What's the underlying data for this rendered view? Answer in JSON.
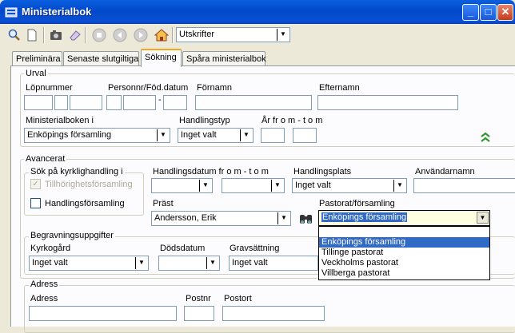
{
  "window": {
    "title": "Ministerialbok"
  },
  "toolbar": {
    "icons": [
      "search-icon",
      "new-document-icon",
      "camera-icon",
      "eraser-icon",
      "stop-icon",
      "back-icon",
      "forward-icon",
      "home-icon"
    ],
    "report_combo_value": "Utskrifter"
  },
  "tabs": [
    {
      "label": "Preliminära"
    },
    {
      "label": "Senaste slutgiltiga"
    },
    {
      "label": "Sökning"
    },
    {
      "label": "Spåra ministerialbok"
    }
  ],
  "urval": {
    "legend": "Urval",
    "lopnummer_label": "Löpnummer",
    "personnr_label": "Personnr/Föd.datum",
    "personnr_dash": "-",
    "fornamn_label": "Förnamn",
    "efternamn_label": "Efternamn",
    "ministerialboken_label": "Ministerialboken i",
    "ministerialboken_value": "Enköpings församling",
    "handlingstyp_label": "Handlingstyp",
    "handlingstyp_value": "Inget valt",
    "ar_label": "År fr o m - t o m"
  },
  "avancerat": {
    "legend": "Avancerat",
    "kyrklig": {
      "legend": "Sök på kyrklighandling i",
      "tillhorighet_label": "Tillhörighetsförsamling",
      "tillhorighet_checked": true,
      "handlings_label": "Handlingsförsamling",
      "handlings_checked": false
    },
    "handlingsdatum_label": "Handlingsdatum fr o m - t o m",
    "handlingsplats_label": "Handlingsplats",
    "handlingsplats_value": "Inget valt",
    "anvandarnamn_label": "Användarnamn",
    "prast_label": "Präst",
    "prast_value": "Andersson, Erik",
    "pastorat_label": "Pastorat/församling",
    "pastorat_value": "Enköpings församling",
    "pastorat_options": [
      "",
      "Enköpings församling",
      "Tillinge pastorat",
      "Veckholms pastorat",
      "Villberga pastorat"
    ],
    "pastorat_selected_index": 1
  },
  "begravning": {
    "legend": "Begravningsuppgifter",
    "kyrkogard_label": "Kyrkogård",
    "kyrkogard_value": "Inget valt",
    "dodsdatum_label": "Dödsdatum",
    "gravsattning_label": "Gravsättning",
    "gravsattning_value": "Inget valt"
  },
  "adress": {
    "legend": "Adress",
    "adress_label": "Adress",
    "postnr_label": "Postnr",
    "postort_label": "Postort"
  },
  "colors": {
    "titlebar": "#0a5fe0",
    "selection": "#316ac5",
    "active_tab_accent": "#f5a71b",
    "expand_icon": "#2e9a2e"
  }
}
